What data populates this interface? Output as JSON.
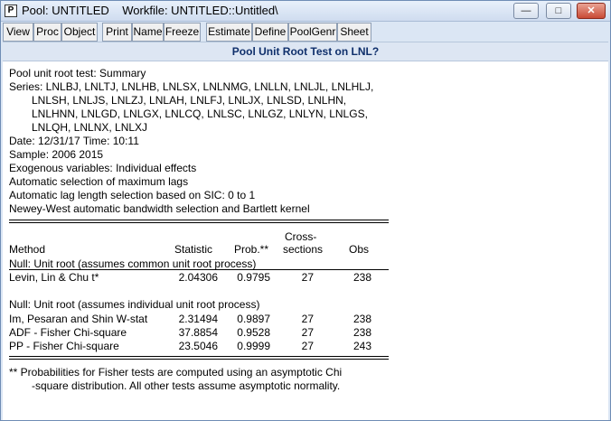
{
  "window": {
    "title": "Pool: UNTITLED    Workfile: UNTITLED::Untitled\\",
    "app_icon_letter": "P",
    "controls": {
      "minimize": "—",
      "maximize": "□",
      "close": "✕"
    }
  },
  "toolbar": [
    "View",
    "Proc",
    "Object",
    "Print",
    "Name",
    "Freeze",
    "Estimate",
    "Define",
    "PoolGenr",
    "Sheet"
  ],
  "header": "Pool Unit Root Test on LNL?",
  "summary": {
    "line1": "Pool unit root test: Summary",
    "series_lines": [
      "Series: LNLBJ, LNLTJ, LNLHB, LNLSX, LNLNMG, LNLLN, LNLJL, LNLHLJ,",
      "LNLSH, LNLJS, LNLZJ, LNLAH, LNLFJ, LNLJX, LNLSD, LNLHN,",
      "LNLHNN, LNLGD, LNLGX, LNLCQ, LNLSC, LNLGZ, LNLYN, LNLGS,",
      "LNLQH, LNLNX, LNLXJ"
    ],
    "date_line": "Date: 12/31/17   Time: 10:11",
    "sample": "Sample: 2006 2015",
    "exog": "Exogenous variables: Individual effects",
    "maxlag": "Automatic selection of maximum lags",
    "lagsel": "Automatic lag length selection based on SIC: 0 to 1",
    "newey": "Newey-West automatic bandwidth selection and Bartlett kernel"
  },
  "table": {
    "headers": {
      "method": "Method",
      "statistic": "Statistic",
      "prob": "Prob.**",
      "cross_top": "Cross-",
      "cross_bottom": "sections",
      "obs": "Obs"
    },
    "null_common": "Null: Unit root (assumes common unit root process)",
    "common_rows": [
      {
        "method": "Levin, Lin & Chu t*",
        "statistic": "2.04306",
        "prob": "0.9795",
        "cross": "27",
        "obs": "238"
      }
    ],
    "null_individual": "Null: Unit root (assumes individual unit root process)",
    "individual_rows": [
      {
        "method": "Im, Pesaran and Shin W-stat",
        "statistic": "2.31494",
        "prob": "0.9897",
        "cross": "27",
        "obs": "238"
      },
      {
        "method": "ADF - Fisher Chi-square",
        "statistic": "37.8854",
        "prob": "0.9528",
        "cross": "27",
        "obs": "238"
      },
      {
        "method": "PP - Fisher Chi-square",
        "statistic": "23.5046",
        "prob": "0.9999",
        "cross": "27",
        "obs": "243"
      }
    ]
  },
  "footnote": {
    "line1": "** Probabilities for Fisher tests are computed using an asymptotic Chi",
    "line2": "-square distribution. All other tests assume asymptotic normality."
  }
}
